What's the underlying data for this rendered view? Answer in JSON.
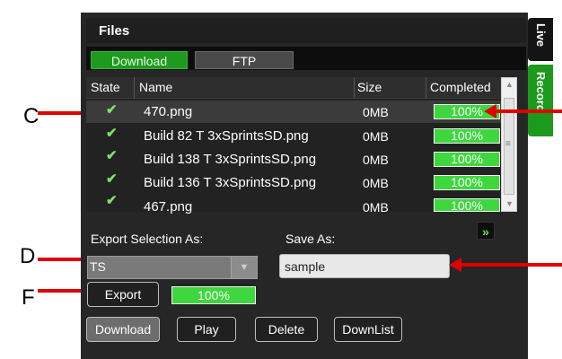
{
  "panel": {
    "title": "Files"
  },
  "tabs": {
    "download": "Download",
    "ftp": "FTP"
  },
  "side_tabs": {
    "live": "Live",
    "record": "Record"
  },
  "table": {
    "headers": {
      "state": "State",
      "name": "Name",
      "size": "Size",
      "completed": "Completed"
    },
    "rows": [
      {
        "state": "✔",
        "name": "470.png",
        "size": "0MB",
        "completed": "100%"
      },
      {
        "state": "✔",
        "name": "Build 82 T 3xSprintsSD.png",
        "size": "0MB",
        "completed": "100%"
      },
      {
        "state": "✔",
        "name": "Build 138 T 3xSprintsSD.png",
        "size": "0MB",
        "completed": "100%"
      },
      {
        "state": "✔",
        "name": "Build 136 T 3xSprintsSD.png",
        "size": "0MB",
        "completed": "100%"
      },
      {
        "state": "✔",
        "name": "467.png",
        "size": "0MB",
        "completed": "100%"
      }
    ]
  },
  "export": {
    "label": "Export Selection As:",
    "value": "TS",
    "save_label": "Save As:",
    "save_value": "sample",
    "button": "Export",
    "progress": "100%"
  },
  "actions": {
    "download": "Download",
    "play": "Play",
    "delete": "Delete",
    "downlist": "DownList"
  },
  "callouts": {
    "c": "C",
    "d": "D",
    "f": "F"
  },
  "icons": {
    "check": "check-icon",
    "expand": "double-chevron-down-icon",
    "dropdown": "dropdown-arrow-icon"
  },
  "colors": {
    "accent_green": "#3ed83e",
    "panel": "#262626",
    "arrow": "#e00000"
  }
}
